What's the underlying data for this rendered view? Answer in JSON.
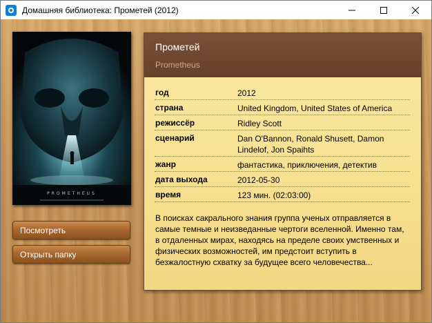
{
  "window": {
    "title": "Домашняя библиотека: Прометей (2012)",
    "icon": "app-icon"
  },
  "colors": {
    "header_bg": "#6e4730",
    "card_bg": "#f6df8e",
    "button_bg": "#a8682f",
    "wood_bg": "#c79a5f"
  },
  "poster": {
    "caption": "PROMETHEUS"
  },
  "buttons": {
    "watch": "Посмотреть",
    "open_folder": "Открыть папку"
  },
  "movie": {
    "title": "Прометей",
    "original_title": "Prometheus",
    "info": [
      {
        "key": "год",
        "value": "2012"
      },
      {
        "key": "страна",
        "value": "United Kingdom, United States of America"
      },
      {
        "key": "режиссёр",
        "value": "Ridley Scott"
      },
      {
        "key": "сценарий",
        "value": "Dan O'Bannon, Ronald Shusett, Damon Lindelof, Jon Spaihts"
      },
      {
        "key": "жанр",
        "value": "фантастика, приключения, детектив"
      },
      {
        "key": "дата выхода",
        "value": "2012-05-30"
      },
      {
        "key": "время",
        "value": "123 мин. (02:03:00)"
      }
    ],
    "description": "В поисках сакрального знания группа ученых отправляется в самые темные и неизведанные чертоги вселенной. Именно там, в отдаленных мирах, находясь на пределе своих умственных и физических возможностей, им предстоит вступить в безжалостную схватку за будущее всего человечества..."
  }
}
